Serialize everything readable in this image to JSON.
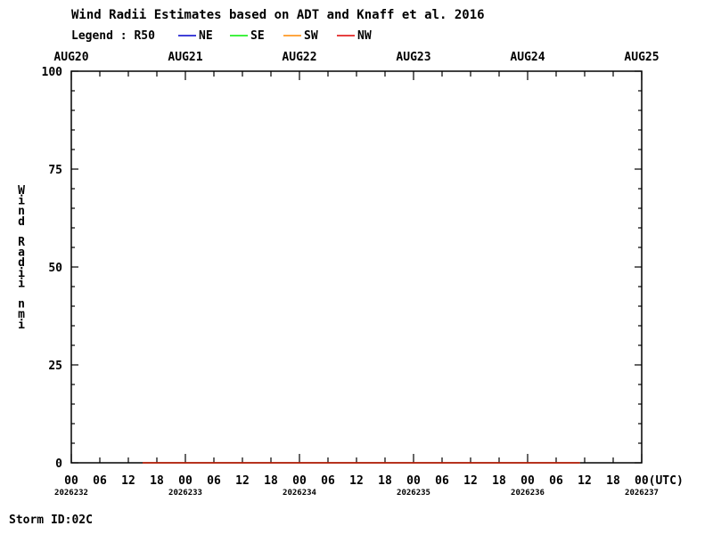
{
  "chart_data": {
    "type": "line",
    "title": "Wind Radii Estimates based on ADT and Knaff et al. 2016",
    "legend": {
      "title": "Legend : R50",
      "placement": "top",
      "entries": [
        {
          "name": "NE",
          "color": "#0000cc"
        },
        {
          "name": "SE",
          "color": "#00ee00"
        },
        {
          "name": "SW",
          "color": "#ff8800"
        },
        {
          "name": "NW",
          "color": "#dd0000"
        }
      ]
    },
    "ylabel": "Wind Radii nmi",
    "ylim": [
      0,
      100
    ],
    "yticks": [
      0,
      25,
      50,
      75,
      100
    ],
    "x_date_labels": [
      "AUG20",
      "AUG21",
      "AUG22",
      "AUG23",
      "AUG24",
      "AUG25"
    ],
    "x_hour_labels": [
      "00",
      "06",
      "12",
      "18",
      "00",
      "06",
      "12",
      "18",
      "00",
      "06",
      "12",
      "18",
      "00",
      "06",
      "12",
      "18",
      "00",
      "06",
      "12",
      "18",
      "00(UTC)"
    ],
    "x_julian_labels": [
      "2026232",
      "2026233",
      "2026234",
      "2026235",
      "2026236",
      "2026237"
    ],
    "x_range_hours": [
      0,
      120
    ],
    "grid": false,
    "series": [
      {
        "name": "NE",
        "color": "#0000cc",
        "x_hours": [
          15,
          107
        ],
        "values": [
          0,
          0
        ]
      },
      {
        "name": "SE",
        "color": "#00ee00",
        "x_hours": [
          15,
          107
        ],
        "values": [
          0,
          0
        ]
      },
      {
        "name": "SW",
        "color": "#ff8800",
        "x_hours": [
          15,
          107
        ],
        "values": [
          0,
          0
        ]
      },
      {
        "name": "NW",
        "color": "#dd0000",
        "x_hours": [
          15,
          107
        ],
        "values": [
          0,
          0
        ]
      }
    ]
  },
  "footer": {
    "storm_id": "Storm ID:02C"
  }
}
